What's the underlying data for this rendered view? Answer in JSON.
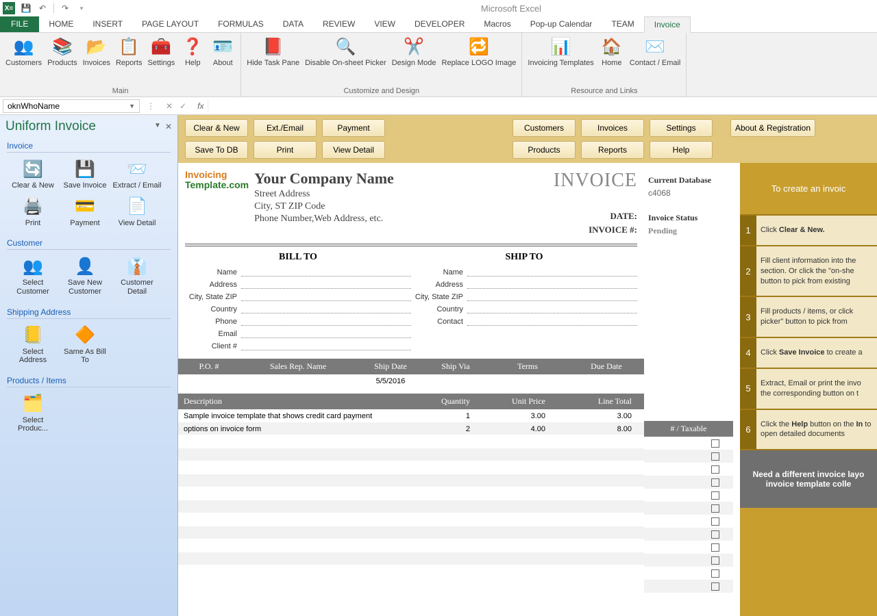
{
  "app_title": "Microsoft Excel",
  "qat": {
    "save": "💾",
    "undo": "↶",
    "redo": "↷"
  },
  "tabs": [
    "FILE",
    "HOME",
    "INSERT",
    "PAGE LAYOUT",
    "FORMULAS",
    "DATA",
    "REVIEW",
    "VIEW",
    "DEVELOPER",
    "Macros",
    "Pop-up Calendar",
    "TEAM",
    "Invoice"
  ],
  "active_tab": "Invoice",
  "ribbon": {
    "groups": [
      {
        "label": "Main",
        "items": [
          {
            "name": "customers",
            "label": "Customers",
            "icon": "👥"
          },
          {
            "name": "products",
            "label": "Products",
            "icon": "📚"
          },
          {
            "name": "invoices",
            "label": "Invoices",
            "icon": "📂"
          },
          {
            "name": "reports",
            "label": "Reports",
            "icon": "📋"
          },
          {
            "name": "settings",
            "label": "Settings",
            "icon": "🧰"
          },
          {
            "name": "help",
            "label": "Help",
            "icon": "❓"
          },
          {
            "name": "about",
            "label": "About",
            "icon": "🪪"
          }
        ]
      },
      {
        "label": "Customize and Design",
        "items": [
          {
            "name": "hide-task-pane",
            "label": "Hide Task Pane",
            "icon": "📕"
          },
          {
            "name": "disable-onsheet-picker",
            "label": "Disable On-sheet Picker",
            "icon": "🔍"
          },
          {
            "name": "design-mode",
            "label": "Design Mode",
            "icon": "✂️"
          },
          {
            "name": "replace-logo",
            "label": "Replace LOGO Image",
            "icon": "🔁"
          }
        ]
      },
      {
        "label": "Resource and Links",
        "items": [
          {
            "name": "invoicing-templates",
            "label": "Invoicing Templates",
            "icon": "📊"
          },
          {
            "name": "home",
            "label": "Home",
            "icon": "🏠"
          },
          {
            "name": "contact-email",
            "label": "Contact / Email",
            "icon": "✉️"
          }
        ]
      }
    ]
  },
  "namebox": "oknWhoName",
  "fx_label": "fx",
  "taskpane": {
    "title": "Uniform Invoice",
    "sections": [
      {
        "title": "Invoice",
        "items": [
          {
            "name": "clear-new",
            "label": "Clear & New",
            "icon": "🔄"
          },
          {
            "name": "save-invoice",
            "label": "Save Invoice",
            "icon": "💾"
          },
          {
            "name": "extract-email",
            "label": "Extract / Email",
            "icon": "📨"
          },
          {
            "name": "print",
            "label": "Print",
            "icon": "🖨️"
          },
          {
            "name": "payment",
            "label": "Payment",
            "icon": "💳"
          },
          {
            "name": "view-detail",
            "label": "View Detail",
            "icon": "📄"
          }
        ]
      },
      {
        "title": "Customer",
        "items": [
          {
            "name": "select-customer",
            "label": "Select Customer",
            "icon": "👥"
          },
          {
            "name": "save-new-customer",
            "label": "Save New Customer",
            "icon": "👤"
          },
          {
            "name": "customer-detail",
            "label": "Customer Detail",
            "icon": "👔"
          }
        ]
      },
      {
        "title": "Shipping Address",
        "items": [
          {
            "name": "select-address",
            "label": "Select Address",
            "icon": "📒"
          },
          {
            "name": "same-as-bill",
            "label": "Same As Bill To",
            "icon": "🔶"
          }
        ]
      },
      {
        "title": "Products / Items",
        "items": [
          {
            "name": "select-products",
            "label": "Select Produc...",
            "icon": "🗂️"
          }
        ]
      }
    ]
  },
  "actionbar": {
    "col1": [
      "Clear & New",
      "Save To DB"
    ],
    "col2": [
      "Ext./Email",
      "Print"
    ],
    "col3": [
      "Payment",
      "View Detail"
    ],
    "col4": [
      "Customers",
      "Products"
    ],
    "col5": [
      "Invoices",
      "Reports"
    ],
    "col6": [
      "Settings",
      "Help"
    ],
    "about": "About & Registration"
  },
  "invoice": {
    "company_name": "Your Company Name",
    "street": "Street Address",
    "city": "City, ST  ZIP Code",
    "phone": "Phone Number,Web Address, etc.",
    "title": "INVOICE",
    "date_label": "DATE:",
    "num_label": "INVOICE #:",
    "logo_top": "Invoicing",
    "logo_bot": "Template.com",
    "bill_to": "BILL TO",
    "ship_to": "SHIP TO",
    "addr_labels_bill": [
      "Name",
      "Address",
      "City, State ZIP",
      "Country",
      "Phone",
      "Email",
      "Client #"
    ],
    "addr_labels_ship": [
      "Name",
      "Address",
      "City, State ZIP",
      "Country",
      "Contact"
    ],
    "detail_headers": [
      "P.O. #",
      "Sales Rep. Name",
      "Ship Date",
      "Ship Via",
      "Terms",
      "Due Date"
    ],
    "ship_date": "5/5/2016",
    "item_headers": [
      "Description",
      "Quantity",
      "Unit Price",
      "Line Total"
    ],
    "items": [
      {
        "desc": "Sample invoice template that shows credit card payment",
        "qty": "1",
        "up": "3.00",
        "lt": "3.00"
      },
      {
        "desc": "options on invoice form",
        "qty": "2",
        "up": "4.00",
        "lt": "8.00"
      }
    ],
    "tax_header": "# / Taxable"
  },
  "db": {
    "title": "Current Database",
    "value": "c4068",
    "status_label": "Invoice Status",
    "status_value": "Pending"
  },
  "help": {
    "intro": "To create an invoic",
    "steps": [
      "Click <b>Clear & New.</b>",
      "Fill client information into the section. Or click the \"on-she button to pick from existing",
      "Fill products / items, or click picker\" button to pick from",
      "Click <b>Save Invoice</b> to create a",
      "Extract, Email or print the invo the corresponding button on t",
      "Click the <b>Help</b> button on the <b>In</b> to open detailed documents"
    ],
    "footer": "Need a different invoice layo invoice template colle"
  }
}
